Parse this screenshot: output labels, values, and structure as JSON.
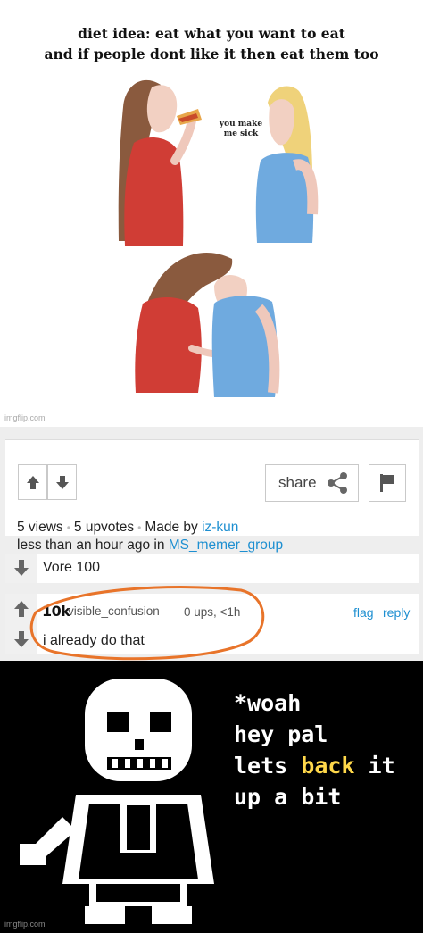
{
  "comic": {
    "title_line1": "diet idea: eat what you want to eat",
    "title_line2": "and if people dont like it then eat them too",
    "speech": "you make me sick",
    "watermark": "imgflip.com"
  },
  "post": {
    "share_label": "share",
    "views": "5 views",
    "upvotes": "5 upvotes",
    "made_by_label": "Made by",
    "author": "iz-kun",
    "time_label": "less than an hour ago in",
    "stream": "MS_memer_group"
  },
  "comments": [
    {
      "text": "Vore 100"
    },
    {
      "badge": "10k",
      "username": "visible_confusion",
      "meta": "0 ups, <1h",
      "flag": "flag",
      "reply": "reply",
      "text": "i already do that"
    }
  ],
  "caption": {
    "line1": "*woah",
    "line2": "hey pal",
    "line3_a": "lets ",
    "line3_b": "back",
    "line3_c": " it",
    "line4": "up a bit",
    "highlight_color": "#ffd84a"
  },
  "bottom_watermark": "imgflip.com",
  "colors": {
    "link": "#1d8fd1",
    "circle": "#e8742a"
  }
}
